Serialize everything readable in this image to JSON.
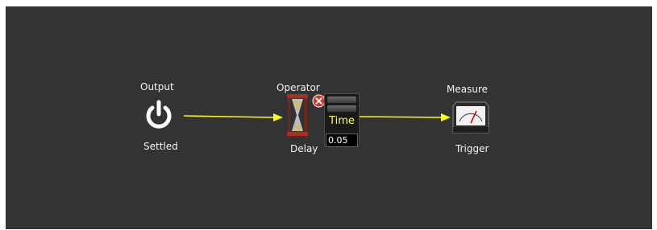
{
  "nodes": {
    "output": {
      "title": "Output",
      "subtitle": "Settled",
      "icon": "power-icon"
    },
    "operator": {
      "title": "Operator",
      "subtitle": "Delay",
      "icon": "hourglass-icon",
      "close_icon": "close-icon",
      "param": {
        "name": "Time",
        "value": "0.05"
      }
    },
    "measure": {
      "title": "Measure",
      "subtitle": "Trigger",
      "icon": "meter-gauge-icon"
    }
  },
  "colors": {
    "canvas": "#333333",
    "wire": "#ffff00",
    "param_text": "#ffff33",
    "close": "#d9342b"
  }
}
